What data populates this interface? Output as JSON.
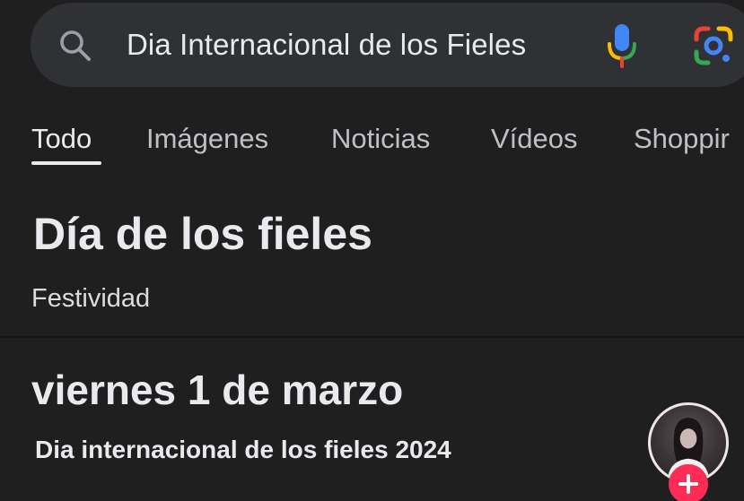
{
  "search": {
    "query": "Dia Internacional de los Fieles",
    "icons": {
      "search": "search-icon",
      "mic": "mic-icon",
      "lens": "google-lens-icon"
    }
  },
  "tabs": [
    {
      "label": "Todo",
      "active": true
    },
    {
      "label": "Imágenes",
      "active": false
    },
    {
      "label": "Noticias",
      "active": false
    },
    {
      "label": "Vídeos",
      "active": false
    },
    {
      "label": "Shoppir",
      "active": false
    }
  ],
  "knowledge_panel": {
    "title": "Día de los fieles",
    "subtitle": "Festividad"
  },
  "result": {
    "date": "viernes 1 de marzo",
    "caption": "Dia internacional de los fieles 2024"
  },
  "overlay": {
    "avatar_icon": "profile-avatar",
    "follow_icon": "plus-icon"
  },
  "colors": {
    "background": "#1f1f1f",
    "search_bar": "#303134",
    "text_primary": "#e8eaed",
    "text_secondary": "#bdc1c6",
    "follow_badge": "#fe2c55"
  }
}
